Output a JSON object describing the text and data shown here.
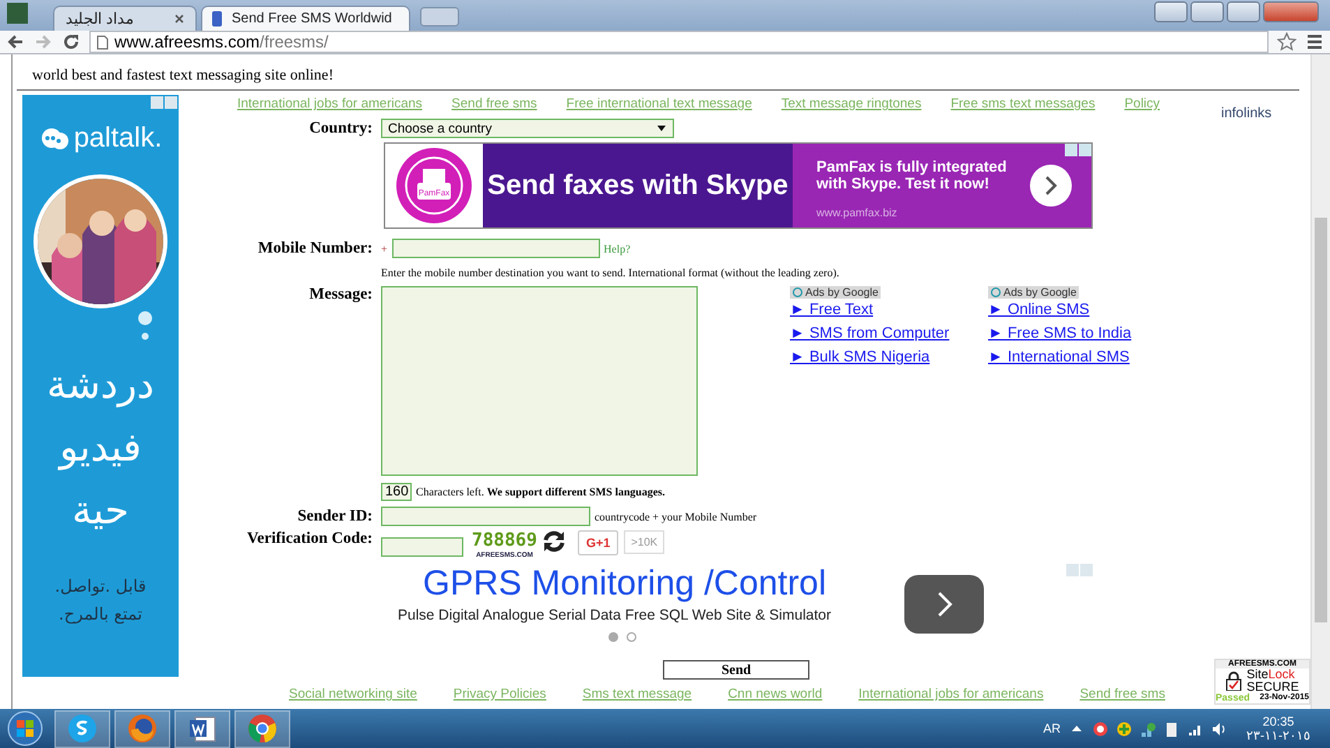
{
  "browser": {
    "tabs": [
      {
        "title": "مداد الجليد",
        "selected": false
      },
      {
        "title": "Send Free SMS Worldwid",
        "selected": true
      }
    ],
    "url_domain": "www.afreesms.com",
    "url_path": "/freesms/"
  },
  "page": {
    "intro_text": "world best and fastest text messaging site online!",
    "nav_links": [
      "International jobs for americans",
      "Send free sms",
      "Free international text message",
      "Text message ringtones",
      "Free sms text messages",
      "Policy"
    ],
    "infolinks_label": "infolinks",
    "side_ad": {
      "brand": "paltalk.",
      "headline_lines": [
        "دردشة",
        "فيديو",
        "حية"
      ],
      "tagline_lines": [
        ".قابل .تواصل",
        ".تمتع بالمرح"
      ]
    },
    "form": {
      "country": {
        "label": "Country:",
        "value": "Choose a country"
      },
      "banner_ad": {
        "logo_text": "PamFax",
        "headline": "Send faxes with Skype",
        "body": "PamFax is fully integrated with Skype. Test it now!",
        "url": "www.pamfax.biz"
      },
      "mobile": {
        "label": "Mobile Number:",
        "prefix": "+",
        "help": "Help?",
        "hint": "Enter the mobile number destination you want to send. International format (without the leading zero)."
      },
      "message": {
        "label": "Message:"
      },
      "ad_columns": [
        {
          "badge": "Ads by Google",
          "links": [
            "► Free Text",
            "► SMS from Computer",
            "► Bulk SMS Nigeria"
          ]
        },
        {
          "badge": "Ads by Google",
          "links": [
            "► Online SMS",
            "► Free SMS to India",
            "► International SMS"
          ]
        }
      ],
      "counter": {
        "value": "160",
        "text": "Characters left. **We support different SMS languages.**"
      },
      "sender_id": {
        "label": "Sender ID:",
        "hint": "countrycode + your Mobile Number"
      },
      "verification": {
        "label": "Verification Code:",
        "captcha_code": "788869",
        "captcha_site": "AFREESMS.COM",
        "plus_button": "G+1",
        "plus_count": ">10K"
      },
      "gprs_ad": {
        "title": "GPRS Monitoring /Control",
        "subtitle": "Pulse Digital Analogue Serial Data Free SQL Web Site & Simulator",
        "slides": [
          {
            "selected": true
          },
          {
            "selected": false
          }
        ]
      },
      "send_button": "Send"
    },
    "footer_links": [
      "Social networking site",
      "Privacy Policies",
      "Sms text message",
      "Cnn news world",
      "International jobs for americans",
      "Send free sms"
    ],
    "sitelock": {
      "site": "AFREESMS.COM",
      "brand_a": "Site",
      "brand_b": "Lock",
      "secure": "SECURE",
      "status": "Passed",
      "date": "23-Nov-2015"
    }
  },
  "taskbar": {
    "apps": [
      {
        "kind": "skype"
      },
      {
        "kind": "firefox"
      },
      {
        "kind": "word"
      },
      {
        "kind": "chrome"
      }
    ],
    "language": "AR",
    "time": "20:35",
    "date": "٢٠١٥-١١-٢٣"
  }
}
